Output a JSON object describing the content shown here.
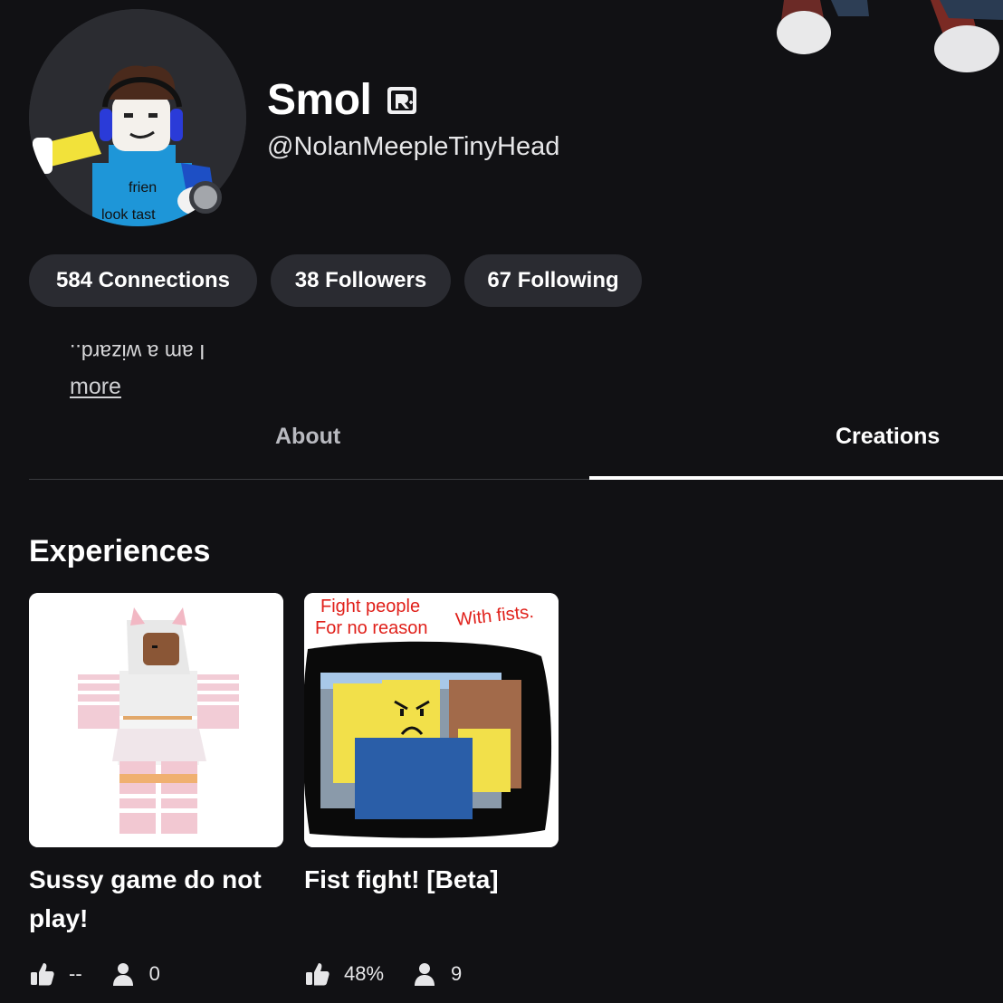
{
  "profile": {
    "display_name": "Smol",
    "username": "@NolanMeepleTinyHead",
    "bio": "I am a wizard..",
    "more_label": "more",
    "avatar_shirt_text": "frien look tast"
  },
  "stats": [
    {
      "label": "584 Connections"
    },
    {
      "label": "38 Followers"
    },
    {
      "label": "67 Following"
    }
  ],
  "tabs": [
    {
      "label": "About",
      "active": false
    },
    {
      "label": "Creations",
      "active": true
    }
  ],
  "experiences": {
    "title": "Experiences",
    "items": [
      {
        "title": "Sussy game do not play!",
        "rating": "--",
        "players": "0"
      },
      {
        "title": "Fist fight! [Beta]",
        "rating": "48%",
        "players": "9",
        "thumb_text_1": "Fight people",
        "thumb_text_2": "For no reason",
        "thumb_text_3": "With fists."
      }
    ]
  },
  "icons": {
    "verified": "verified-badge-icon",
    "like": "thumbs-up-icon",
    "players": "person-icon"
  },
  "colors": {
    "background": "#111114",
    "pill": "#2a2b31",
    "presence": "#a3a6ab",
    "thumb_text": "#e0201a"
  }
}
